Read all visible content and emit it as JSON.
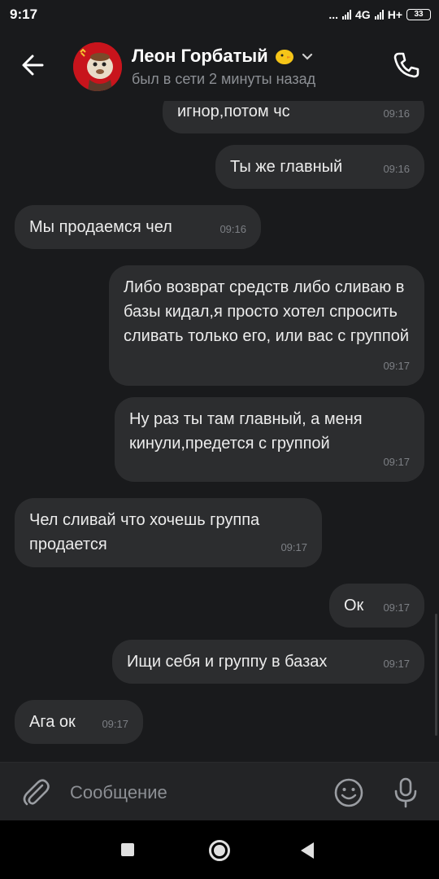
{
  "status_bar": {
    "time": "9:17",
    "dots": "...",
    "network_1": "4G",
    "network_2": "H+",
    "battery": "33"
  },
  "header": {
    "contact_name": "Леон Горбатый",
    "status": "был в сети 2 минуты назад",
    "icons": {
      "back": "arrow-left-icon",
      "emoji_badge": "chick-emoji-icon",
      "dropdown": "chevron-down-icon",
      "call": "phone-icon"
    }
  },
  "messages": [
    {
      "side": "out",
      "text": "игнор,потом чс",
      "time": "09:16"
    },
    {
      "side": "out",
      "text": "Ты же главный",
      "time": "09:16"
    },
    {
      "side": "in",
      "text": "Мы продаемся чел",
      "time": "09:16"
    },
    {
      "side": "out",
      "text": "Либо возврат средств либо сливаю в базы кидал,я просто хотел спросить сливать только его, или вас с группой",
      "time": "09:17"
    },
    {
      "side": "out",
      "text": "Ну раз ты там главный, а меня кинули,предется с группой",
      "time": "09:17"
    },
    {
      "side": "in",
      "text": "Чел сливай что хочешь группа продается",
      "time": "09:17"
    },
    {
      "side": "out",
      "text": "Ок",
      "time": "09:17"
    },
    {
      "side": "out",
      "text": "Ищи себя и группу в базах",
      "time": "09:17"
    },
    {
      "side": "in",
      "text": "Ага ок",
      "time": "09:17"
    }
  ],
  "composer": {
    "placeholder": "Сообщение",
    "icons": {
      "attach": "paperclip-icon",
      "emoji": "smiley-icon",
      "mic": "microphone-icon"
    }
  },
  "nav_bar": {
    "icons": {
      "recents": "square-icon",
      "home": "circle-icon",
      "back": "triangle-back-icon"
    }
  },
  "colors": {
    "background": "#191a1c",
    "bubble": "#2c2d2f",
    "composer": "#232426",
    "avatar": "#c8141c"
  }
}
